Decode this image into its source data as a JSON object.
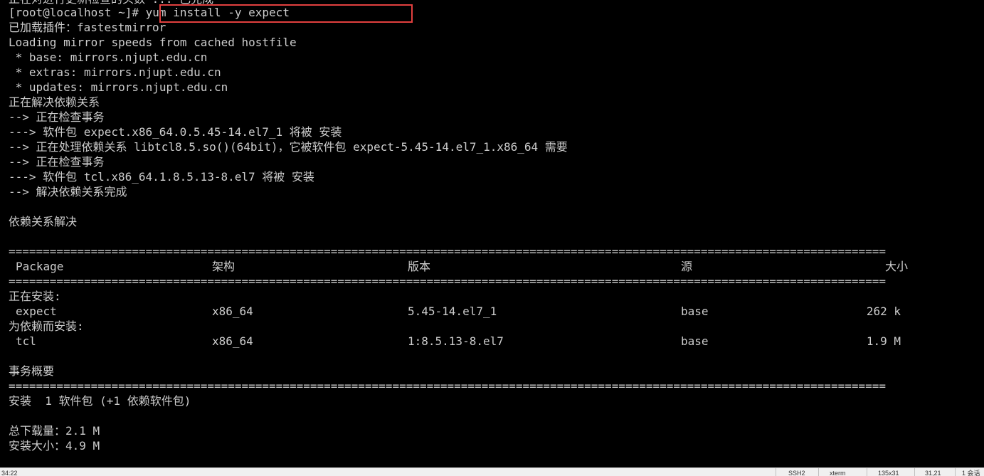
{
  "terminal": {
    "partial_top": "正在对进行更新检查的头数 ... 已完成",
    "prompt": "[root@localhost ~]# ",
    "command": "yum install -y expect",
    "lines": [
      "已加载插件：fastestmirror",
      "Loading mirror speeds from cached hostfile",
      " * base: mirrors.njupt.edu.cn",
      " * extras: mirrors.njupt.edu.cn",
      " * updates: mirrors.njupt.edu.cn",
      "正在解决依赖关系",
      "--> 正在检查事务",
      "---> 软件包 expect.x86_64.0.5.45-14.el7_1 将被 安装",
      "--> 正在处理依赖关系 libtcl8.5.so()(64bit)，它被软件包 expect-5.45-14.el7_1.x86_64 需要",
      "--> 正在检查事务",
      "---> 软件包 tcl.x86_64.1.8.5.13-8.el7 将被 安装",
      "--> 解决依赖关系完成",
      "",
      "依赖关系解决",
      ""
    ],
    "separator": "================================================================================================================================",
    "table_header": {
      "package": "Package",
      "arch": "架构",
      "version": "版本",
      "repo": "源",
      "size": "大小"
    },
    "section_install": "正在安装:",
    "section_deps": "为依赖而安装:",
    "rows": [
      {
        "package": "expect",
        "arch": "x86_64",
        "version": "5.45-14.el7_1",
        "repo": "base",
        "size": "262 k"
      },
      {
        "package": "tcl",
        "arch": "x86_64",
        "version": "1:8.5.13-8.el7",
        "repo": "base",
        "size": "1.9 M"
      }
    ],
    "summary_title": "事务概要",
    "summary_install": "安装  1 软件包 (+1 依赖软件包)",
    "total_download": "总下载量：2.1 M",
    "install_size": "安装大小：4.9 M"
  },
  "statusbar": {
    "left": "34:22",
    "protocol": "SSH2",
    "term": "xterm",
    "size": "135x31",
    "cursor": "31,21",
    "sessions": "1 会话"
  },
  "colors": {
    "background": "#000000",
    "text": "#cccccc",
    "highlight": "#e2403f"
  }
}
